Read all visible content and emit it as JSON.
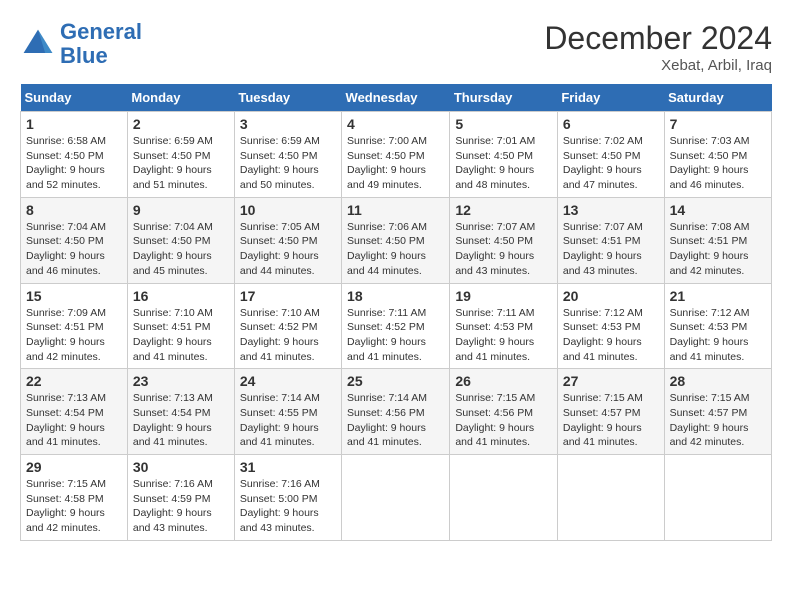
{
  "header": {
    "logo_line1": "General",
    "logo_line2": "Blue",
    "month": "December 2024",
    "location": "Xebat, Arbil, Iraq"
  },
  "days_of_week": [
    "Sunday",
    "Monday",
    "Tuesday",
    "Wednesday",
    "Thursday",
    "Friday",
    "Saturday"
  ],
  "weeks": [
    [
      {
        "num": "1",
        "sunrise": "6:58 AM",
        "sunset": "4:50 PM",
        "daylight": "9 hours and 52 minutes."
      },
      {
        "num": "2",
        "sunrise": "6:59 AM",
        "sunset": "4:50 PM",
        "daylight": "9 hours and 51 minutes."
      },
      {
        "num": "3",
        "sunrise": "6:59 AM",
        "sunset": "4:50 PM",
        "daylight": "9 hours and 50 minutes."
      },
      {
        "num": "4",
        "sunrise": "7:00 AM",
        "sunset": "4:50 PM",
        "daylight": "9 hours and 49 minutes."
      },
      {
        "num": "5",
        "sunrise": "7:01 AM",
        "sunset": "4:50 PM",
        "daylight": "9 hours and 48 minutes."
      },
      {
        "num": "6",
        "sunrise": "7:02 AM",
        "sunset": "4:50 PM",
        "daylight": "9 hours and 47 minutes."
      },
      {
        "num": "7",
        "sunrise": "7:03 AM",
        "sunset": "4:50 PM",
        "daylight": "9 hours and 46 minutes."
      }
    ],
    [
      {
        "num": "8",
        "sunrise": "7:04 AM",
        "sunset": "4:50 PM",
        "daylight": "9 hours and 46 minutes."
      },
      {
        "num": "9",
        "sunrise": "7:04 AM",
        "sunset": "4:50 PM",
        "daylight": "9 hours and 45 minutes."
      },
      {
        "num": "10",
        "sunrise": "7:05 AM",
        "sunset": "4:50 PM",
        "daylight": "9 hours and 44 minutes."
      },
      {
        "num": "11",
        "sunrise": "7:06 AM",
        "sunset": "4:50 PM",
        "daylight": "9 hours and 44 minutes."
      },
      {
        "num": "12",
        "sunrise": "7:07 AM",
        "sunset": "4:50 PM",
        "daylight": "9 hours and 43 minutes."
      },
      {
        "num": "13",
        "sunrise": "7:07 AM",
        "sunset": "4:51 PM",
        "daylight": "9 hours and 43 minutes."
      },
      {
        "num": "14",
        "sunrise": "7:08 AM",
        "sunset": "4:51 PM",
        "daylight": "9 hours and 42 minutes."
      }
    ],
    [
      {
        "num": "15",
        "sunrise": "7:09 AM",
        "sunset": "4:51 PM",
        "daylight": "9 hours and 42 minutes."
      },
      {
        "num": "16",
        "sunrise": "7:10 AM",
        "sunset": "4:51 PM",
        "daylight": "9 hours and 41 minutes."
      },
      {
        "num": "17",
        "sunrise": "7:10 AM",
        "sunset": "4:52 PM",
        "daylight": "9 hours and 41 minutes."
      },
      {
        "num": "18",
        "sunrise": "7:11 AM",
        "sunset": "4:52 PM",
        "daylight": "9 hours and 41 minutes."
      },
      {
        "num": "19",
        "sunrise": "7:11 AM",
        "sunset": "4:53 PM",
        "daylight": "9 hours and 41 minutes."
      },
      {
        "num": "20",
        "sunrise": "7:12 AM",
        "sunset": "4:53 PM",
        "daylight": "9 hours and 41 minutes."
      },
      {
        "num": "21",
        "sunrise": "7:12 AM",
        "sunset": "4:53 PM",
        "daylight": "9 hours and 41 minutes."
      }
    ],
    [
      {
        "num": "22",
        "sunrise": "7:13 AM",
        "sunset": "4:54 PM",
        "daylight": "9 hours and 41 minutes."
      },
      {
        "num": "23",
        "sunrise": "7:13 AM",
        "sunset": "4:54 PM",
        "daylight": "9 hours and 41 minutes."
      },
      {
        "num": "24",
        "sunrise": "7:14 AM",
        "sunset": "4:55 PM",
        "daylight": "9 hours and 41 minutes."
      },
      {
        "num": "25",
        "sunrise": "7:14 AM",
        "sunset": "4:56 PM",
        "daylight": "9 hours and 41 minutes."
      },
      {
        "num": "26",
        "sunrise": "7:15 AM",
        "sunset": "4:56 PM",
        "daylight": "9 hours and 41 minutes."
      },
      {
        "num": "27",
        "sunrise": "7:15 AM",
        "sunset": "4:57 PM",
        "daylight": "9 hours and 41 minutes."
      },
      {
        "num": "28",
        "sunrise": "7:15 AM",
        "sunset": "4:57 PM",
        "daylight": "9 hours and 42 minutes."
      }
    ],
    [
      {
        "num": "29",
        "sunrise": "7:15 AM",
        "sunset": "4:58 PM",
        "daylight": "9 hours and 42 minutes."
      },
      {
        "num": "30",
        "sunrise": "7:16 AM",
        "sunset": "4:59 PM",
        "daylight": "9 hours and 43 minutes."
      },
      {
        "num": "31",
        "sunrise": "7:16 AM",
        "sunset": "5:00 PM",
        "daylight": "9 hours and 43 minutes."
      },
      null,
      null,
      null,
      null
    ]
  ]
}
